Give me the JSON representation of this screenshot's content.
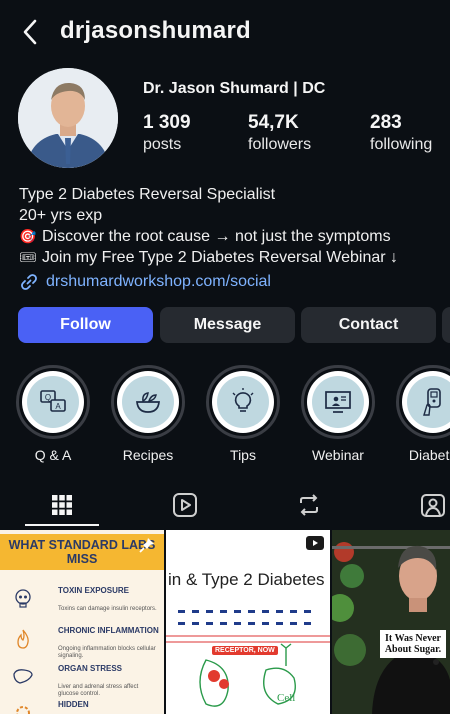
{
  "header": {
    "username": "drjasonshumard",
    "back_icon": "chevron-left-icon"
  },
  "profile": {
    "display_name": "Dr. Jason Shumard | DC",
    "stats": [
      {
        "value": "1 309",
        "label": "posts"
      },
      {
        "value": "54,7K",
        "label": "followers"
      },
      {
        "value": "283",
        "label": "following"
      }
    ],
    "bio": {
      "line1": "Type 2 Diabetes Reversal Specialist",
      "line2": "20+ yrs exp",
      "line3_emoji": "🎯",
      "line3": "Discover the root cause → not just the symptoms",
      "line4_emoji": "🎟",
      "line4": "Join my Free Type 2 Diabetes Reversal Webinar ↓"
    },
    "link": "drshumardworkshop.com/social"
  },
  "actions": {
    "follow": "Follow",
    "message": "Message",
    "contact": "Contact"
  },
  "highlights": [
    {
      "label": "Q & A",
      "icon": "qa-icon"
    },
    {
      "label": "Recipes",
      "icon": "bowl-icon"
    },
    {
      "label": "Tips",
      "icon": "lightbulb-icon"
    },
    {
      "label": "Webinar",
      "icon": "presentation-icon"
    },
    {
      "label": "Diabete",
      "icon": "glucose-meter-icon"
    }
  ],
  "tabs": [
    "grid-icon",
    "reels-icon",
    "reposts-icon",
    "tagged-icon"
  ],
  "posts": {
    "post1": {
      "banner": "WHAT STANDARD LABS MISS",
      "items": [
        {
          "title": "TOXIN EXPOSURE",
          "desc": "Toxins can damage insulin receptors."
        },
        {
          "title": "CHRONIC INFLAMMATION",
          "desc": "Ongoing inflammation blocks cellular signaling."
        },
        {
          "title": "ORGAN STRESS",
          "desc": "Liver and adrenal stress affect glucose control."
        },
        {
          "title": "HIDDEN",
          "desc": ""
        }
      ]
    },
    "post2": {
      "title": "in & Type 2 Diabetes",
      "tag": "RECEPTOR, NOW",
      "cell_label": "Cell"
    },
    "post3": {
      "sign": "It Was Never About Sugar."
    }
  },
  "colors": {
    "follow": "#4a61f5",
    "link": "#7fb3ff",
    "background": "#0b0f14"
  }
}
